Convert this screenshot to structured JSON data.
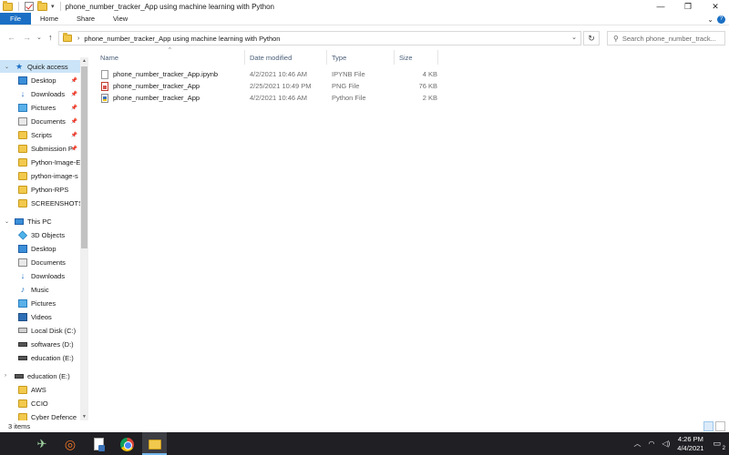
{
  "window": {
    "title": "phone_number_tracker_App using machine learning with Python",
    "controls": {
      "minimize": "—",
      "maximize": "❐",
      "close": "✕"
    }
  },
  "ribbon": {
    "tabs": [
      {
        "label": "File"
      },
      {
        "label": "Home"
      },
      {
        "label": "Share"
      },
      {
        "label": "View"
      }
    ],
    "help": "?"
  },
  "address": {
    "back": "←",
    "forward": "→",
    "recent": "⌄",
    "up": "↑",
    "breadcrumb": "phone_number_tracker_App using machine learning with Python",
    "search_placeholder": "Search phone_number_track..."
  },
  "nav": {
    "quick_access": "Quick access",
    "quick_items": [
      {
        "label": "Desktop",
        "icon": "desktop-icon",
        "pinned": true
      },
      {
        "label": "Downloads",
        "icon": "downloads-icon",
        "pinned": true
      },
      {
        "label": "Pictures",
        "icon": "pictures-icon",
        "pinned": true
      },
      {
        "label": "Documents",
        "icon": "documents-icon",
        "pinned": true
      },
      {
        "label": "Scripts",
        "icon": "folder-icon",
        "pinned": true
      },
      {
        "label": "Submission P",
        "icon": "folder-icon",
        "pinned": true
      },
      {
        "label": "Python-Image-E",
        "icon": "folder-icon",
        "pinned": false
      },
      {
        "label": "python-image-s",
        "icon": "folder-icon",
        "pinned": false
      },
      {
        "label": "Python-RPS",
        "icon": "folder-icon",
        "pinned": false
      },
      {
        "label": "SCREENSHOTS",
        "icon": "folder-icon",
        "pinned": false
      }
    ],
    "this_pc": "This PC",
    "pc_items": [
      {
        "label": "3D Objects",
        "icon": "3d-objects-icon"
      },
      {
        "label": "Desktop",
        "icon": "desktop-icon"
      },
      {
        "label": "Documents",
        "icon": "documents-icon"
      },
      {
        "label": "Downloads",
        "icon": "downloads-icon"
      },
      {
        "label": "Music",
        "icon": "music-icon"
      },
      {
        "label": "Pictures",
        "icon": "pictures-icon"
      },
      {
        "label": "Videos",
        "icon": "videos-icon"
      },
      {
        "label": "Local Disk (C:)",
        "icon": "drive-icon"
      },
      {
        "label": "softwares (D:)",
        "icon": "drive-icon"
      },
      {
        "label": "education (E:)",
        "icon": "drive-icon"
      }
    ],
    "drive_e": "education (E:)",
    "drive_e_items": [
      {
        "label": "AWS",
        "icon": "folder-icon"
      },
      {
        "label": "CCIO",
        "icon": "folder-icon"
      },
      {
        "label": "Cyber Defence",
        "icon": "folder-icon"
      }
    ]
  },
  "files": {
    "columns": {
      "name": "Name",
      "date": "Date modified",
      "type": "Type",
      "size": "Size"
    },
    "rows": [
      {
        "name": "phone_number_tracker_App.ipynb",
        "date": "4/2/2021 10:46 AM",
        "type": "IPYNB File",
        "size": "4 KB",
        "icon": "notebook-file-icon"
      },
      {
        "name": "phone_number_tracker_App",
        "date": "2/25/2021 10:49 PM",
        "type": "PNG File",
        "size": "76 KB",
        "icon": "png-file-icon"
      },
      {
        "name": "phone_number_tracker_App",
        "date": "4/2/2021 10:46 AM",
        "type": "Python File",
        "size": "2 KB",
        "icon": "python-file-icon"
      }
    ]
  },
  "status": {
    "count": "3 items"
  },
  "taskbar": {
    "time": "4:26 PM",
    "date": "4/4/2021",
    "notification_badge": "2"
  }
}
